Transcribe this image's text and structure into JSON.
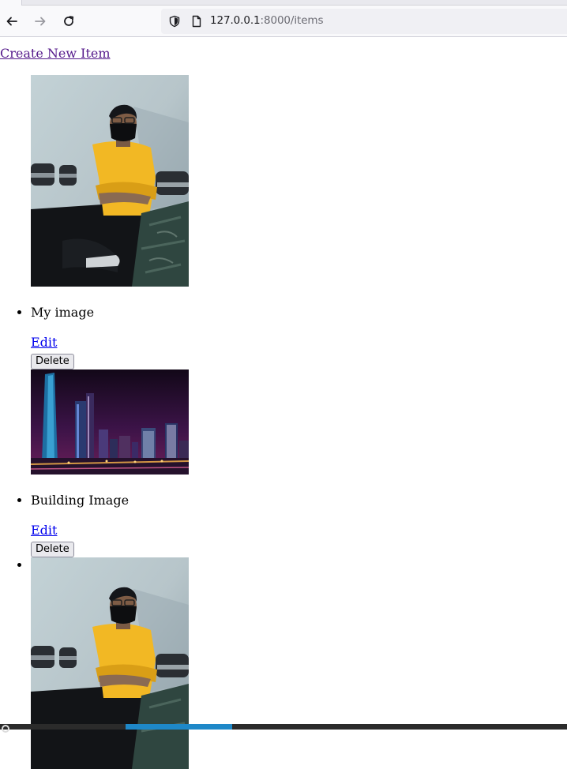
{
  "browser": {
    "url_host": "127.0.0.1",
    "url_rest": ":8000/items",
    "back_icon": "back-arrow-icon",
    "forward_icon": "forward-arrow-icon",
    "reload_icon": "reload-icon",
    "shield_icon": "shield-icon",
    "page_icon": "page-icon"
  },
  "page": {
    "create_link": "Create New Item",
    "items": [
      {
        "name": "My image",
        "edit": "Edit",
        "delete": "Delete",
        "image": "person-photo"
      },
      {
        "name": "Building Image",
        "edit": "Edit",
        "delete": "Delete",
        "image": "city-night-photo"
      },
      {
        "name": "",
        "edit": "",
        "delete": "",
        "image": "person-photo"
      }
    ]
  },
  "colors": {
    "link": "#0000ee",
    "visited_link": "#551a8b",
    "shirt": "#f2b824",
    "city_sky": "#2a0f3a"
  }
}
